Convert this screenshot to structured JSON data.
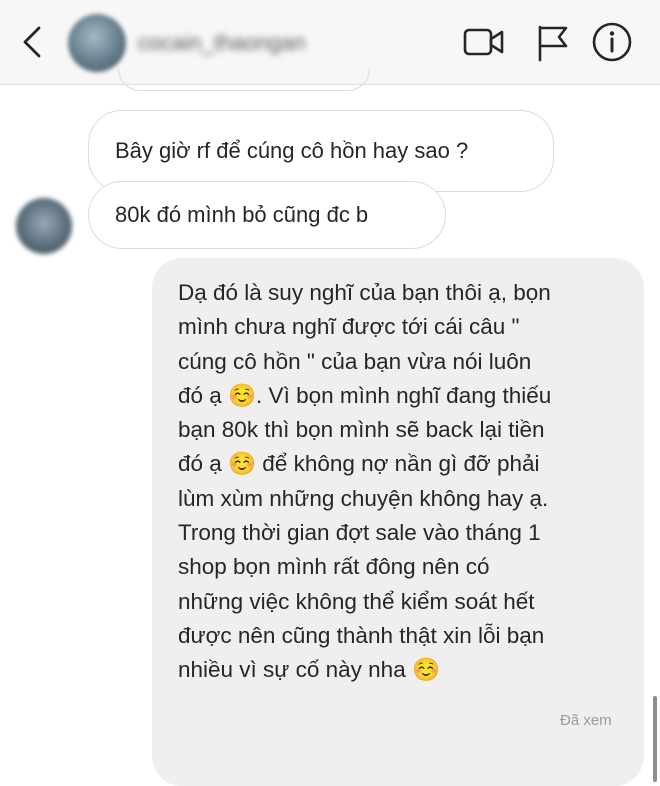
{
  "header": {
    "username": "cocain_thaongan",
    "icons": [
      "back-arrow-icon",
      "avatar",
      "video-call-icon",
      "flag-icon",
      "info-icon"
    ]
  },
  "messages": [
    {
      "direction": "incoming",
      "text": "Bây giờ rf để cúng cô hồn hay sao ?"
    },
    {
      "direction": "incoming",
      "text": "80k đó mình bỏ cũng đc b"
    },
    {
      "direction": "outgoing",
      "lines": [
        "Dạ đó là suy nghĩ của bạn thôi ạ, bọn",
        "mình chưa nghĩ được tới cái câu \"",
        "cúng cô hồn \" của bạn vừa nói luôn",
        "đó ạ ☺️. Vì bọn mình nghĩ đang thiếu",
        "bạn 80k thì bọn mình sẽ back lại tiền",
        "đó ạ ☺️ để không nợ nần gì đỡ phải",
        "lùm xùm những chuyện không hay ạ.",
        "Trong thời gian đợt sale vào tháng 1",
        "shop bọn mình rất đông nên có",
        "những việc không thể kiểm soát hết",
        "được nên cũng thành thật xin lỗi bạn",
        "nhiều vì sự cố này nha ☺️"
      ]
    }
  ],
  "status": {
    "seen": "Đã xem"
  },
  "colors": {
    "header_bg": "#f7f7f7",
    "outgoing_bubble": "#efefef",
    "incoming_border": "#dbdbdb",
    "text": "#262626",
    "meta": "#9a9a9a"
  }
}
